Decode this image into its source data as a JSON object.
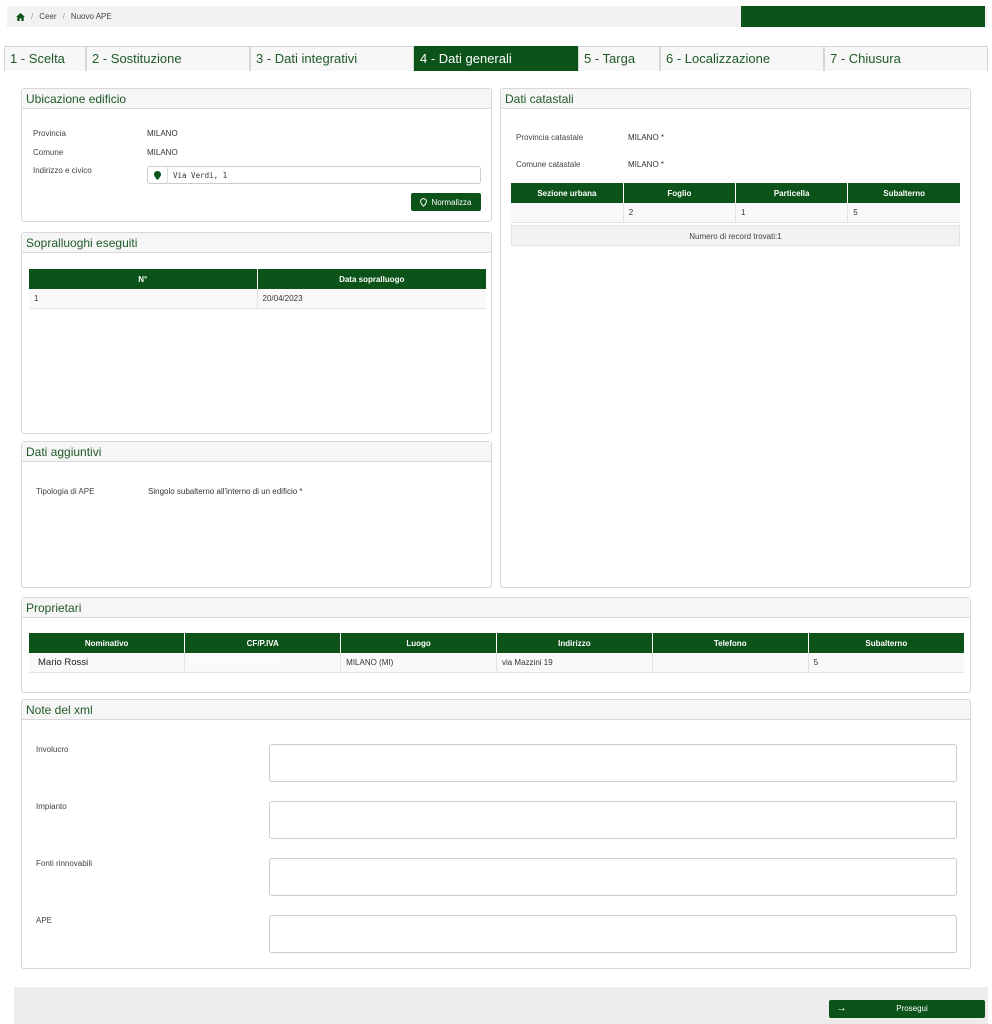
{
  "breadcrumb": {
    "items": [
      "Ceer",
      "Nuovo APE"
    ],
    "separator": "/"
  },
  "tabs": [
    {
      "label": "1 - Scelta",
      "active": false
    },
    {
      "label": "2 - Sostituzione",
      "active": false
    },
    {
      "label": "3 - Dati integrativi",
      "active": false
    },
    {
      "label": "4 - Dati generali",
      "active": true
    },
    {
      "label": "5 - Targa",
      "active": false
    },
    {
      "label": "6 - Localizzazione",
      "active": false
    },
    {
      "label": "7 - Chiusura",
      "active": false
    }
  ],
  "ubicazione": {
    "title": "Ubicazione edificio",
    "provincia_label": "Provincia",
    "provincia_value": "MILANO",
    "comune_label": "Comune",
    "comune_value": "MILANO",
    "indirizzo_label": "Indirizzo e civico",
    "indirizzo_value": "Via Verdi, 1",
    "normalizza_label": "Normalizza"
  },
  "sopralluoghi": {
    "title": "Sopralluoghi eseguiti",
    "columns": [
      "N°",
      "Data sopralluogo"
    ],
    "rows": [
      [
        "1",
        "20/04/2023"
      ]
    ]
  },
  "dati_aggiuntivi": {
    "title": "Dati aggiuntivi",
    "tipologia_label": "Tipologia di APE",
    "tipologia_value": "Singolo subalterno all'interno di un edificio *"
  },
  "dati_catastali": {
    "title": "Dati catastali",
    "provincia_label": "Provincia catastale",
    "provincia_value": "MILANO *",
    "comune_label": "Comune catastale",
    "comune_value": "MILANO *",
    "columns": [
      "Sezione urbana",
      "Foglio",
      "Particella",
      "Subalterno"
    ],
    "rows": [
      [
        "",
        "2",
        "1",
        "5"
      ]
    ],
    "records_text": "Numero di record trovati:1"
  },
  "proprietari": {
    "title": "Proprietari",
    "columns": [
      "Nominativo",
      "CF/P.IVA",
      "Luogo",
      "Indirizzo",
      "Telefono",
      "Subalterno"
    ],
    "rows": [
      [
        "Mario Rossi",
        "",
        "MILANO (MI)",
        "via Mazzini 19",
        "",
        "5"
      ]
    ]
  },
  "note_xml": {
    "title": "Note del xml",
    "fields": [
      {
        "label": "Involucro",
        "value": ""
      },
      {
        "label": "Impianto",
        "value": ""
      },
      {
        "label": "Fonti rinnovabili",
        "value": ""
      },
      {
        "label": "APE",
        "value": ""
      }
    ]
  },
  "footer": {
    "prosegui_label": "Prosegui"
  },
  "colors": {
    "primary": "#0b5318",
    "header_bg": "#f6f6f6",
    "border": "#d8d8d8"
  },
  "icons": {
    "home": "home-icon",
    "location": "map-marker-icon",
    "arrow": "arrow-right-icon"
  }
}
